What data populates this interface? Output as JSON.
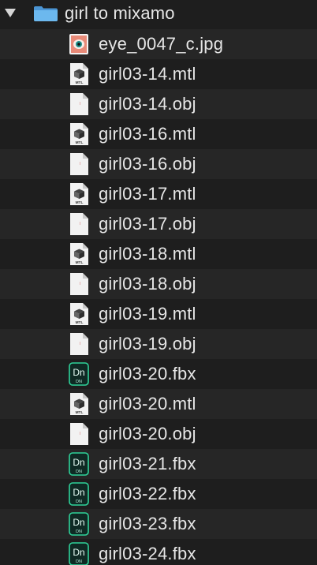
{
  "folder": {
    "name": "girl to mixamo",
    "icon": "folder-icon",
    "expanded": true
  },
  "files": [
    {
      "name": "eye_0047_c.jpg",
      "type": "jpg"
    },
    {
      "name": "girl03-14.mtl",
      "type": "mtl"
    },
    {
      "name": "girl03-14.obj",
      "type": "obj"
    },
    {
      "name": "girl03-16.mtl",
      "type": "mtl"
    },
    {
      "name": "girl03-16.obj",
      "type": "obj"
    },
    {
      "name": "girl03-17.mtl",
      "type": "mtl"
    },
    {
      "name": "girl03-17.obj",
      "type": "obj"
    },
    {
      "name": "girl03-18.mtl",
      "type": "mtl"
    },
    {
      "name": "girl03-18.obj",
      "type": "obj"
    },
    {
      "name": "girl03-19.mtl",
      "type": "mtl"
    },
    {
      "name": "girl03-19.obj",
      "type": "obj"
    },
    {
      "name": "girl03-20.fbx",
      "type": "fbx"
    },
    {
      "name": "girl03-20.mtl",
      "type": "mtl"
    },
    {
      "name": "girl03-20.obj",
      "type": "obj"
    },
    {
      "name": "girl03-21.fbx",
      "type": "fbx"
    },
    {
      "name": "girl03-22.fbx",
      "type": "fbx"
    },
    {
      "name": "girl03-23.fbx",
      "type": "fbx"
    },
    {
      "name": "girl03-24.fbx",
      "type": "fbx"
    }
  ],
  "icon_labels": {
    "mtl": "MTL",
    "fbx_top": "Dn",
    "fbx_bottom": "DN"
  },
  "colors": {
    "background": "#1e1e1e",
    "alt_row": "#262626",
    "text": "#e6e6e6",
    "folder": "#5aa8e6",
    "fbx_accent": "#2fd39a"
  }
}
